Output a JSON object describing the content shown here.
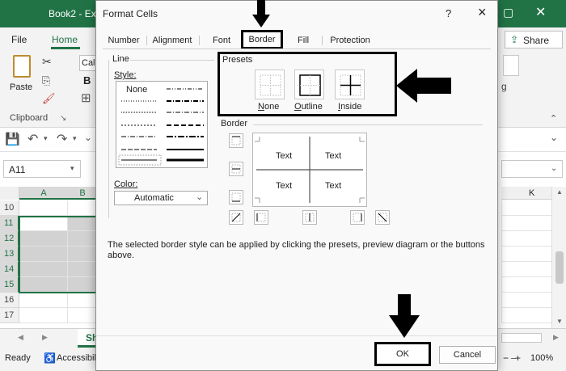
{
  "excel": {
    "title_fragment": "Book2 - Ex",
    "tabs": {
      "file": "File",
      "home": "Home",
      "share": "Share"
    },
    "ribbon": {
      "paste": "Paste",
      "font_fragment": "Cali",
      "bold": "B",
      "clipboard_group": "Clipboard",
      "style_fragment": "g"
    },
    "name_box": "A11",
    "columns": {
      "a": "A",
      "b": "B",
      "k": "K"
    },
    "rows": [
      "10",
      "11",
      "12",
      "13",
      "14",
      "15",
      "16",
      "17"
    ],
    "selected_rows": [
      "11",
      "12",
      "13",
      "14",
      "15"
    ],
    "sheet_tab_fragment": "Sh",
    "status": {
      "ready": "Ready",
      "accessibility": "Accessibil",
      "zoom": "100%",
      "minus": "−",
      "plus": "+"
    }
  },
  "dialog": {
    "title": "Format Cells",
    "help": "?",
    "close": "×",
    "tabs": [
      "Number",
      "Alignment",
      "Font",
      "Border",
      "Fill",
      "Protection"
    ],
    "active_tab": "Border",
    "line": {
      "group_label": "Line",
      "style_label": "Style:",
      "none_label": "None",
      "color_label": "Color:",
      "color_value": "Automatic"
    },
    "presets": {
      "group_label": "Presets",
      "items": [
        {
          "label": "None",
          "accel": "N",
          "rest": "one"
        },
        {
          "label": "Outline",
          "accel": "O",
          "rest": "utline"
        },
        {
          "label": "Inside",
          "accel": "I",
          "rest": "nside"
        }
      ]
    },
    "border": {
      "group_label": "Border",
      "preview_text": [
        "Text",
        "Text",
        "Text",
        "Text"
      ]
    },
    "description": "The selected border style can be applied by clicking the presets, preview diagram or the buttons above.",
    "ok": "OK",
    "cancel": "Cancel"
  },
  "colors": {
    "excel_green": "#217346",
    "annotation": "#000000"
  }
}
